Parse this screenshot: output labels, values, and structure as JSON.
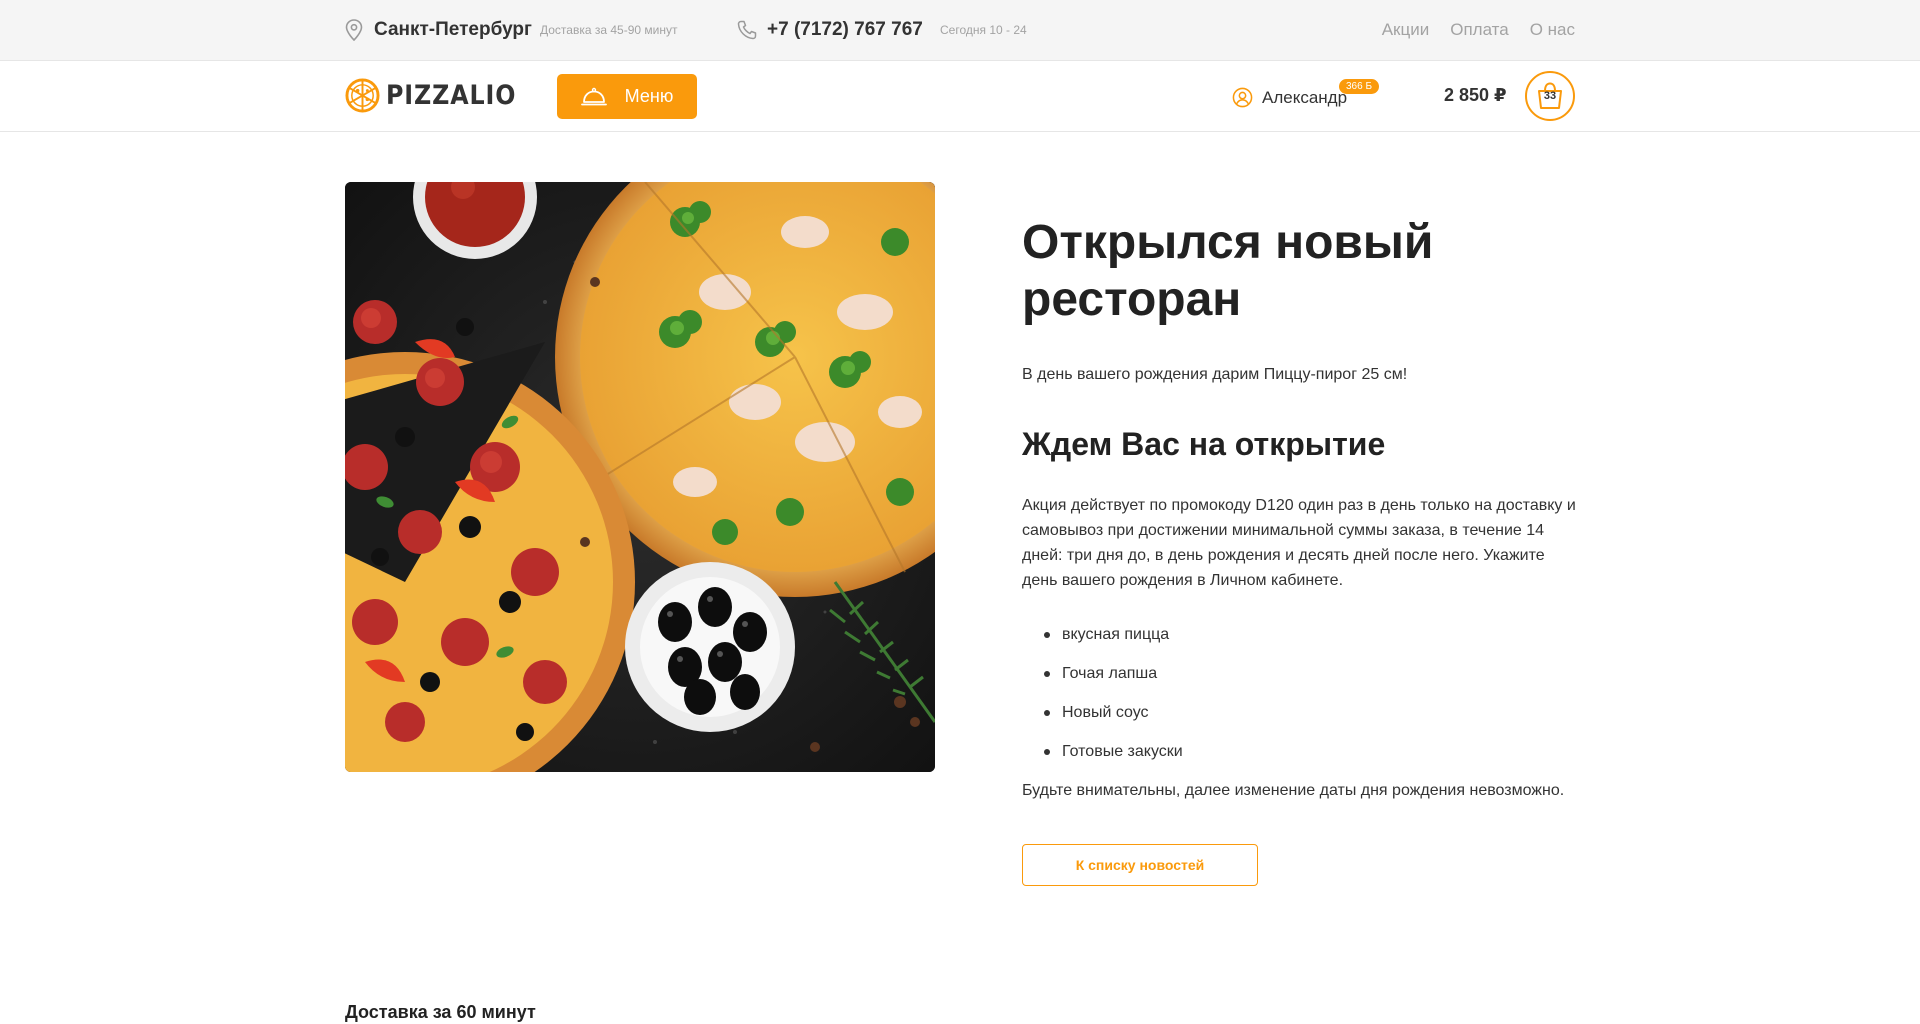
{
  "topbar": {
    "city": "Санкт-Петербург",
    "delivery_time": "Доставка за 45-90 минут",
    "phone": "+7 (7172) 767 767",
    "hours": "Сегодня 10 - 24",
    "links": [
      "Акции",
      "Оплата",
      "О нас"
    ]
  },
  "header": {
    "logo_text": "PIZZALIO",
    "menu_label": "Меню",
    "user_name": "Александр",
    "bonus": "366 Б",
    "cart_total": "2 850 ₽",
    "cart_count": "33"
  },
  "article": {
    "title": "Открылся новый ресторан",
    "lead": "В день вашего рождения дарим Пиццу-пирог 25 см!",
    "subtitle": "Ждем Вас на открытие",
    "body": "Акция действует по промокоду D120 один раз в день только на доставку и самовывоз при достижении минимальной суммы заказа, в течение 14 дней: три дня до, в день рождения и десять дней после него. Укажите день вашего рождения в Личном кабинете.",
    "bullets": [
      "вкусная пицца",
      "Гочая лапша",
      "Новый соус",
      "Готовые закуски"
    ],
    "note": "Будьте внимательны, далее изменение даты дня рождения невозможно.",
    "back_label": "К списку новостей"
  },
  "footer": {
    "heading": "Доставка за 60 минут"
  },
  "colors": {
    "accent": "#fa9a0c",
    "text": "#333333",
    "muted": "#a3a3a3",
    "topbar_bg": "#f5f5f5"
  },
  "icons": [
    "location-pin-icon",
    "phone-icon",
    "pizza-logo-icon",
    "cloche-icon",
    "user-icon",
    "cart-basket-icon"
  ]
}
